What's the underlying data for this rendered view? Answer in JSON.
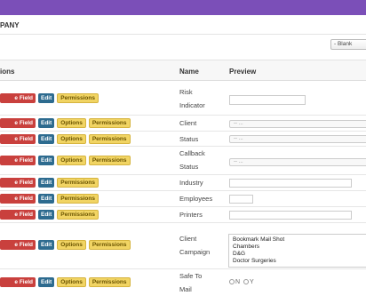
{
  "header": {
    "company": "PANY",
    "blank_button": "- Blank"
  },
  "columns": {
    "actions": "ions",
    "name": "Name",
    "preview": "Preview"
  },
  "buttons": {
    "delete": "e Field",
    "edit": "Edit",
    "options": "Options",
    "permissions": "Permissions"
  },
  "rows": [
    {
      "name": [
        "Risk",
        "Indicator"
      ]
    },
    {
      "name": [
        "Client"
      ],
      "preview_value": "-- ..."
    },
    {
      "name": [
        "Status"
      ],
      "preview_value": "-- ..."
    },
    {
      "name": [
        "Callback",
        "Status"
      ],
      "preview_value": "-- ..."
    },
    {
      "name": [
        "Industry"
      ]
    },
    {
      "name": [
        "Employees"
      ]
    },
    {
      "name": [
        "Printers"
      ]
    },
    {
      "name": [
        "Client",
        "Campaign"
      ],
      "list_options": [
        "Bookmark Mail Shot",
        "Chambers",
        "D&G",
        "Doctor Surgeries"
      ]
    },
    {
      "name": [
        "Safe To",
        "Mail"
      ],
      "radio_options": [
        "N",
        "Y"
      ]
    }
  ],
  "colors": {
    "topbar": "#7b4fb8",
    "delete": "#c9403d",
    "edit": "#2d6b8f",
    "yellow": "#f1d463"
  }
}
